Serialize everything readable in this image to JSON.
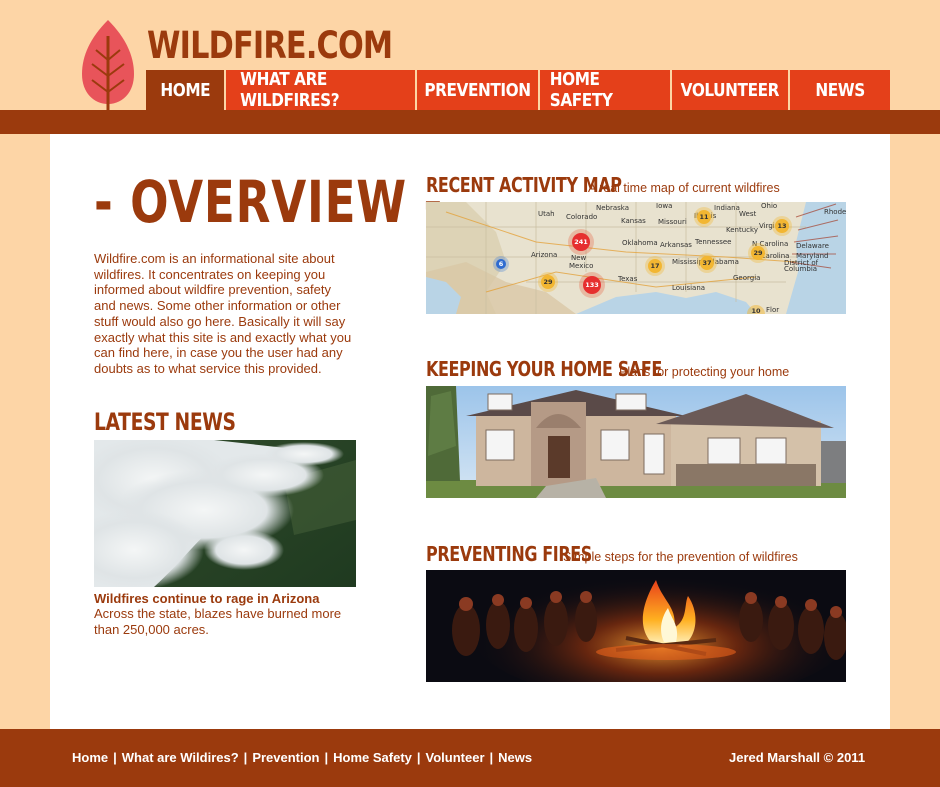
{
  "site": {
    "title": "WILDFIRE.COM"
  },
  "nav": {
    "items": [
      {
        "label": "HOME",
        "active": true
      },
      {
        "label": "WHAT ARE WILDFIRES?"
      },
      {
        "label": "PREVENTION"
      },
      {
        "label": "HOME SAFETY"
      },
      {
        "label": "VOLUNTEER"
      },
      {
        "label": "NEWS"
      }
    ]
  },
  "overview": {
    "title": "- OVERVIEW -",
    "text": "Wildfire.com is an informational site about wildfires. It concentrates on keeping you informed about wildfire prevention, safety and news. Some other information or other stuff would also go here. Basically it will say exactly what this site is and exactly what you can find here, in case you the user had any doubts as to what service this provided."
  },
  "latest_news": {
    "heading": "LATEST NEWS",
    "headline": "Wildfires continue to rage in Arizona",
    "summary": "Across the state, blazes have burned more than 250,000 acres."
  },
  "sections": [
    {
      "title": "RECENT ACTIVITY MAP",
      "subtitle": "A real time map of current wildfires"
    },
    {
      "title": "KEEPING YOUR HOME SAFE",
      "subtitle": "Plans for protecting your home"
    },
    {
      "title": "PREVENTING FIRES",
      "subtitle": "Simple steps for the prevention of wildfires"
    }
  ],
  "map": {
    "states": [
      "Utah",
      "Colorado",
      "Kansas",
      "Missouri",
      "Illinois",
      "West",
      "Oklahoma",
      "Arkansas",
      "Tennessee",
      "Virginia",
      "Rhode",
      "Arizona",
      "New Mexico",
      "Texas",
      "Mississippi",
      "Alabama",
      "Georgia",
      "Louisiana",
      "Nebraska",
      "Iowa",
      "Indiana",
      "Ohio",
      "Kentucky",
      "N Carolina",
      "S Carolina",
      "Delaware",
      "Maryland",
      "District of Columbia",
      "Flor"
    ],
    "clusters": [
      "241",
      "6",
      "29",
      "133",
      "11",
      "17",
      "37",
      "29",
      "13",
      "10"
    ]
  },
  "footer": {
    "links": [
      "Home",
      "What are Wildires?",
      "Prevention",
      "Home Safety",
      "Volunteer",
      "News"
    ],
    "separator": "|",
    "copyright": "Jered Marshall © 2011"
  },
  "colors": {
    "brown": "#9b3a0d",
    "orange": "#e4401a",
    "peach": "#fdd5a6",
    "leaf": "#e8545a"
  }
}
